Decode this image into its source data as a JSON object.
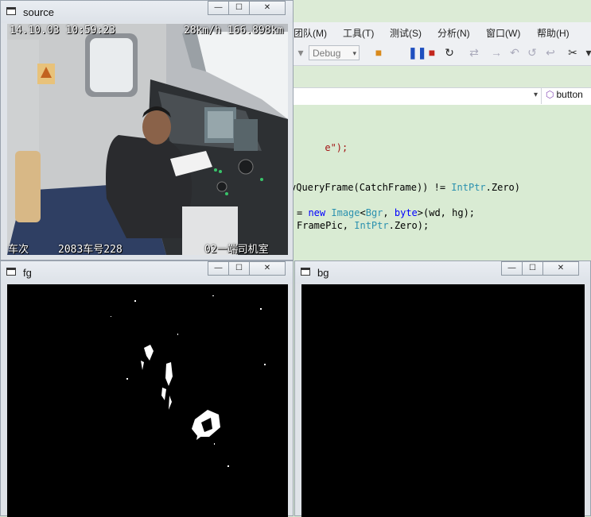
{
  "ide": {
    "menu": [
      "团队(M)",
      "工具(T)",
      "测试(S)",
      "分析(N)",
      "窗口(W)",
      "帮助(H)"
    ],
    "config": "Debug",
    "nav_member": "button",
    "code_lines": {
      "l1": "e\");",
      "l2_pre": "vQueryFrame(CatchFrame)) != ",
      "l2_ty": "IntPtr",
      "l2_post": ".Zero)",
      "l3_pre": "= ",
      "l3_kw": "new",
      "l3_sp": " ",
      "l3_ty": "Image",
      "l3_lt": "<",
      "l3_ty2": "Bgr",
      "l3_c": ", ",
      "l3_kw2": "byte",
      "l3_post": ">(wd, hg);",
      "l4_pre": "FramePic, ",
      "l4_ty": "IntPtr",
      "l4_post": ".Zero);"
    }
  },
  "windows": {
    "source": {
      "title": "source",
      "osd": {
        "datetime": "14.10.03 10:59:23",
        "speed_km": "28km/h 166.898km",
        "train_label": "车次",
        "train_no": "2083车号228",
        "cab": "02一端司机室"
      }
    },
    "fg": {
      "title": "fg"
    },
    "bg": {
      "title": "bg"
    }
  },
  "controls": {
    "minimize": "—",
    "maximize": "☐",
    "close": "✕"
  }
}
